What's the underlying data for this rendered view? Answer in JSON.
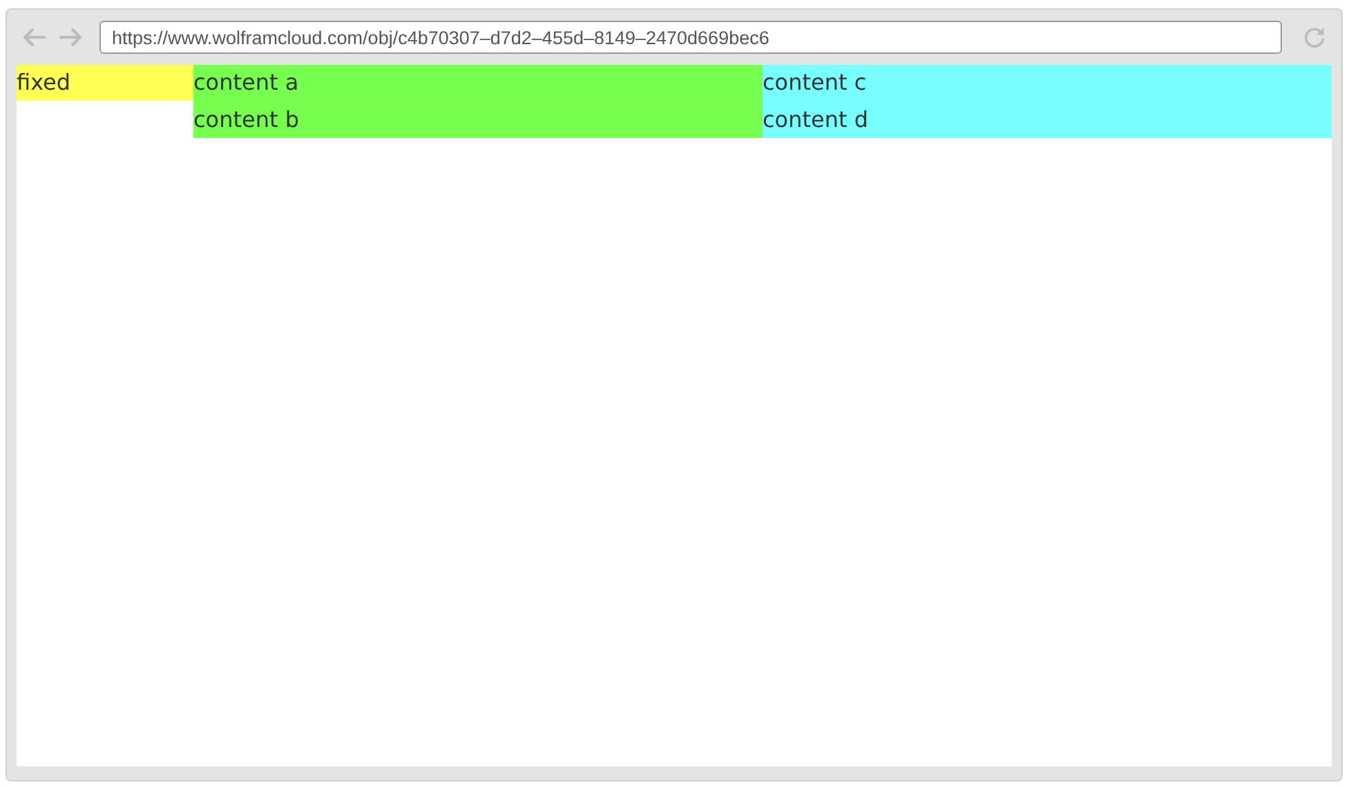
{
  "browser": {
    "url": "https://www.wolframcloud.com/obj/c4b70307–d7d2–455d–8149–2470d669bec6"
  },
  "fixed": {
    "text": "fixed",
    "color": "#ffff55"
  },
  "columns": [
    {
      "color": "#77ff4f",
      "cells": [
        "content a",
        "content b"
      ]
    },
    {
      "color": "#77ffff",
      "cells": [
        "content c",
        "content d"
      ]
    }
  ]
}
